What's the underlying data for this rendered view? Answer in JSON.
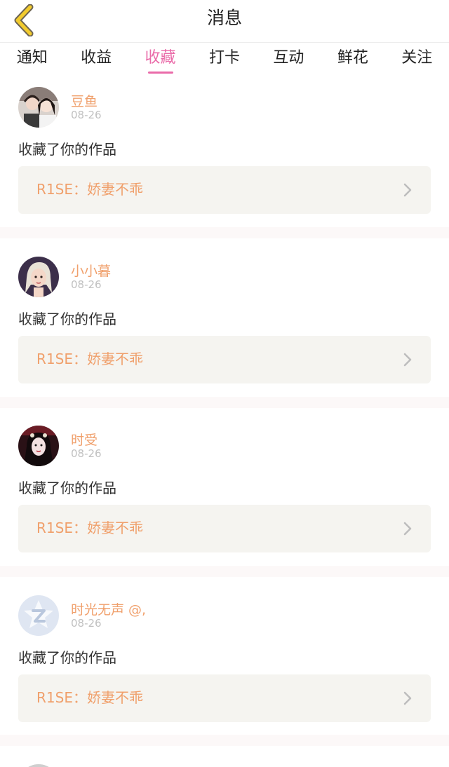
{
  "header": {
    "title": "消息",
    "back_icon": "chevron-left-icon",
    "accent_color": "#f2cb2e"
  },
  "tabs": [
    {
      "label": "通知",
      "active": false
    },
    {
      "label": "收益",
      "active": false
    },
    {
      "label": "收藏",
      "active": true
    },
    {
      "label": "打卡",
      "active": false
    },
    {
      "label": "互动",
      "active": false
    },
    {
      "label": "鲜花",
      "active": false
    },
    {
      "label": "关注",
      "active": false
    }
  ],
  "colors": {
    "active_tab": "#ea6ba9",
    "name_and_work": "#f0a06c",
    "date": "#c0c0c0",
    "work_bg": "#f5f4f0"
  },
  "notifications": [
    {
      "user": "豆鱼",
      "date": "08-26",
      "message": "收藏了你的作品",
      "work": "R1SE：娇妻不乖",
      "avatar": "avatar-photo-two-girls"
    },
    {
      "user": "小小暮",
      "date": "08-26",
      "message": "收藏了你的作品",
      "work": "R1SE：娇妻不乖",
      "avatar": "avatar-illustration-girl"
    },
    {
      "user": "时受",
      "date": "08-26",
      "message": "收藏了你的作品",
      "work": "R1SE：娇妻不乖",
      "avatar": "avatar-photo-girl"
    },
    {
      "user": "时光无声 @,",
      "date": "08-26",
      "message": "收藏了你的作品",
      "work": "R1SE：娇妻不乖",
      "avatar": "avatar-default-logo"
    }
  ]
}
